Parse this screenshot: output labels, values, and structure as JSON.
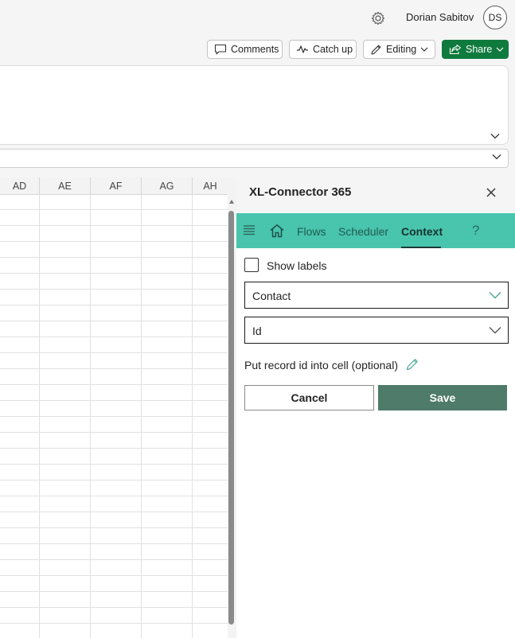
{
  "header": {
    "user_name": "Dorian Sabitov",
    "user_initials": "DS",
    "settings_icon": "gear-icon"
  },
  "toolbar": {
    "comments_label": "Comments",
    "catchup_label": "Catch up",
    "editing_label": "Editing",
    "share_label": "Share",
    "share_color": "#0f7a3d"
  },
  "sheet": {
    "columns": [
      "AD",
      "AE",
      "AF",
      "AG",
      "AH"
    ]
  },
  "addin": {
    "title": "XL-Connector 365",
    "nav": {
      "items": [
        "Flows",
        "Scheduler",
        "Context"
      ],
      "active": "Context",
      "help": "?",
      "bar_color": "#49c4ad"
    },
    "show_labels": {
      "label": "Show labels",
      "checked": false
    },
    "object_select": {
      "value": "Contact"
    },
    "field_select": {
      "value": "Id"
    },
    "cell_hint": "Put record id into cell (optional)",
    "cancel_label": "Cancel",
    "save_label": "Save",
    "save_color": "#4e7b6a"
  }
}
